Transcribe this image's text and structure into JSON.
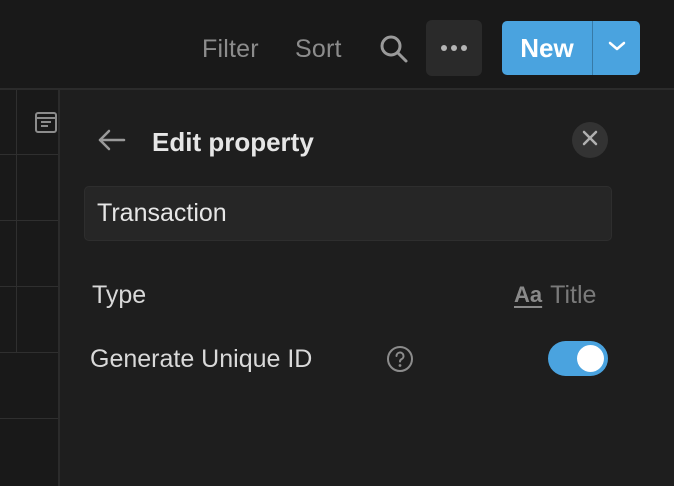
{
  "toolbar": {
    "filter_label": "Filter",
    "sort_label": "Sort",
    "search_icon": "search-icon",
    "more_icon": "more-horizontal-icon",
    "new_label": "New",
    "new_caret_icon": "chevron-down-icon"
  },
  "grid": {
    "property_icon": "calendar-list-icon"
  },
  "panel": {
    "back_icon": "arrow-left-icon",
    "title": "Edit property",
    "close_icon": "close-icon",
    "name_value": "Transaction",
    "type_label": "Type",
    "type_icon_text": "Aa",
    "type_value": "Title",
    "unique_id_label": "Generate Unique ID",
    "help_icon": "question-circle-icon",
    "unique_id_enabled": true
  },
  "colors": {
    "background": "#191919",
    "panel": "#1e1e1e",
    "accent": "#4aa3df",
    "text": "#e6e6e6",
    "muted": "#8c8c8c"
  }
}
